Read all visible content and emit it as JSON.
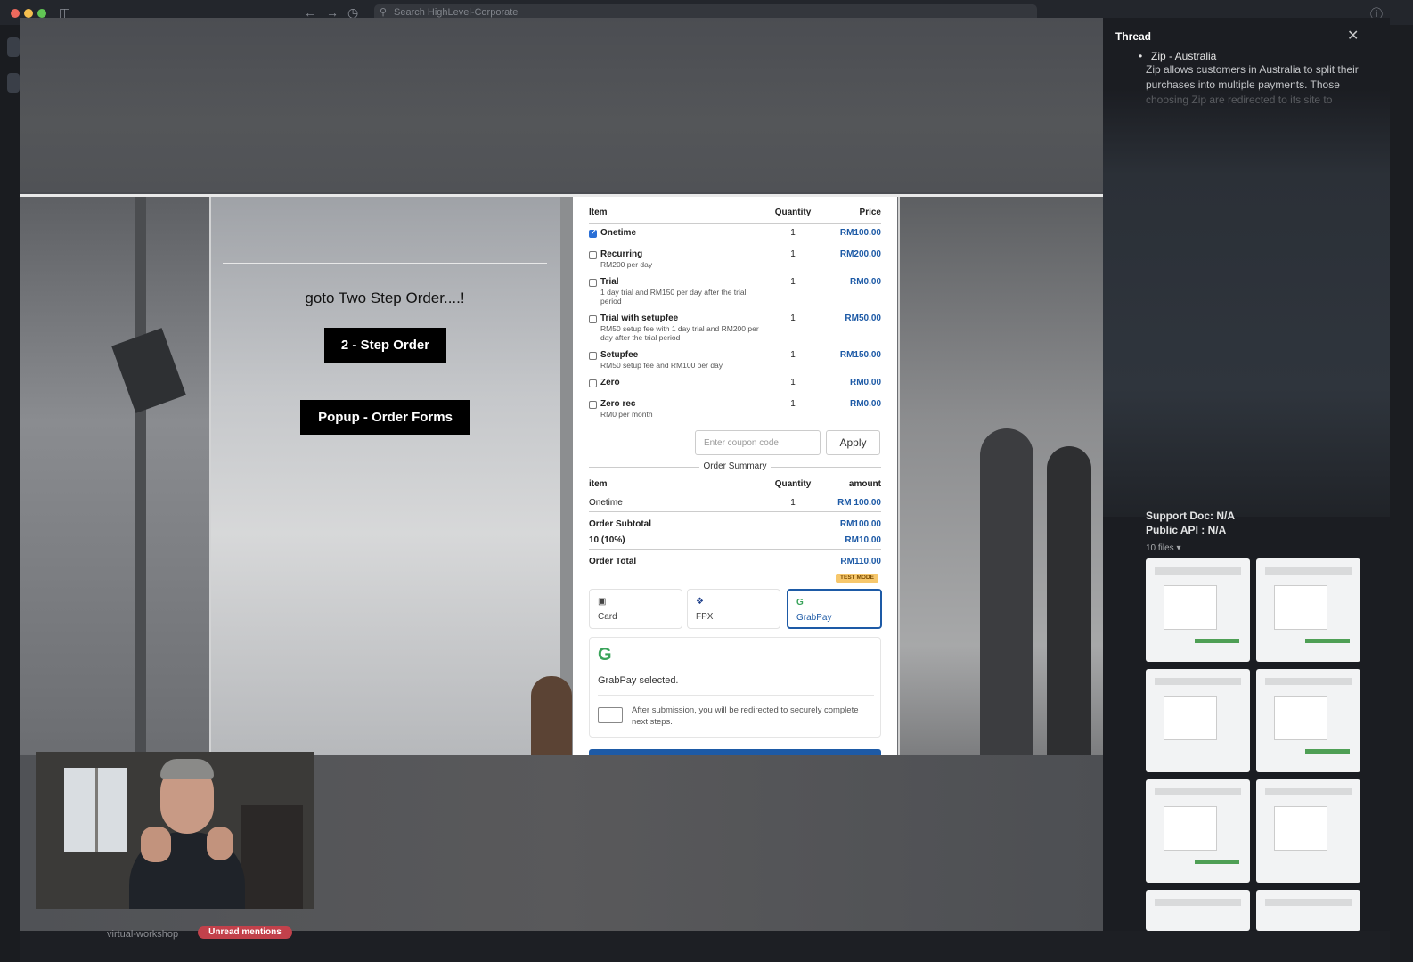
{
  "titlebar": {
    "search_placeholder": "Search HighLevel-Corporate"
  },
  "page": {
    "heading": "goto Two Step Order....!",
    "two_step_button": "2 - Step Order",
    "popup_button": "Popup - Order Forms"
  },
  "order_form": {
    "header": {
      "item": "Item",
      "quantity": "Quantity",
      "price": "Price"
    },
    "products": [
      {
        "name": "Onetime",
        "desc": "",
        "qty": "1",
        "price": "RM100.00",
        "checked": true
      },
      {
        "name": "Recurring",
        "desc": "RM200 per day",
        "qty": "1",
        "price": "RM200.00",
        "checked": false
      },
      {
        "name": "Trial",
        "desc": "1 day trial and RM150 per day after the trial period",
        "qty": "1",
        "price": "RM0.00",
        "checked": false
      },
      {
        "name": "Trial with setupfee",
        "desc": "RM50 setup fee with 1 day trial and RM200 per day after the trial period",
        "qty": "1",
        "price": "RM50.00",
        "checked": false
      },
      {
        "name": "Setupfee",
        "desc": "RM50 setup fee and RM100 per day",
        "qty": "1",
        "price": "RM150.00",
        "checked": false
      },
      {
        "name": "Zero",
        "desc": "",
        "qty": "1",
        "price": "RM0.00",
        "checked": false
      },
      {
        "name": "Zero rec",
        "desc": "RM0 per month",
        "qty": "1",
        "price": "RM0.00",
        "checked": false
      }
    ],
    "coupon_placeholder": "Enter coupon code",
    "apply_label": "Apply",
    "summary_title": "Order Summary",
    "summary_header": {
      "item": "item",
      "quantity": "Quantity",
      "amount": "amount"
    },
    "summary_line": {
      "item": "Onetime",
      "qty": "1",
      "amount": "RM 100.00"
    },
    "subtotal_label": "Order Subtotal",
    "subtotal_value": "RM100.00",
    "tax_label": "10 (10%)",
    "tax_value": "RM10.00",
    "total_label": "Order Total",
    "total_value": "RM110.00",
    "test_mode": "TEST MODE",
    "pay_tabs": [
      {
        "label": "Card",
        "icon": "card-icon"
      },
      {
        "label": "FPX",
        "icon": "fpx-icon"
      },
      {
        "label": "GrabPay",
        "icon": "grabpay-icon",
        "selected": true
      }
    ],
    "grabpay_selected": "GrabPay selected.",
    "grabpay_redirect": "After submission, you will be redirected to securely complete next steps."
  },
  "footer": {
    "channel": "virtual-workshop",
    "badge": "Unread mentions"
  },
  "thread": {
    "title": "Thread",
    "bullet": "Zip - Australia",
    "paragraph": "Zip allows customers in Australia to split their purchases into multiple payments. Those choosing Zip are redirected to its site to",
    "support_doc": "Support Doc: N/A",
    "public_api": "Public API : N/A",
    "files": "10 files"
  },
  "colors": {
    "accent_blue": "#1d5aa6",
    "grab_green": "#39a35a",
    "test_mode": "#f6c76c"
  }
}
